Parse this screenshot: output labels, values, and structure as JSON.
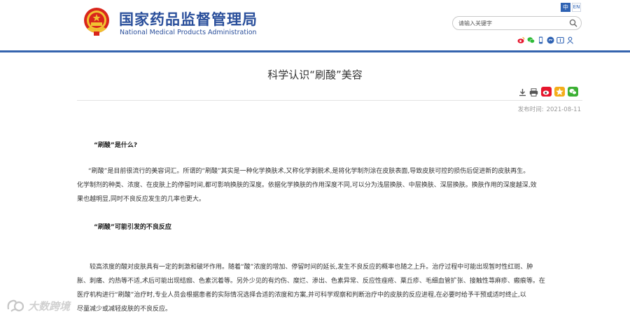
{
  "header": {
    "site_name_cn": "国家药品监督管理局",
    "site_name_en": "National Medical Products Administration",
    "lang_active": "中",
    "lang_other": "EN",
    "search_placeholder": "请输入关键字",
    "social_icons": [
      "weibo-icon",
      "wechat-icon",
      "mobile-app-icon",
      "mini-program-icon",
      "accessibility-icon",
      "user-icon"
    ]
  },
  "article": {
    "title": "科学认识“刷酸”美容",
    "tools": [
      "download-icon",
      "print-icon",
      "share-weibo-icon",
      "share-qzone-icon",
      "share-wechat-icon"
    ],
    "date_label": "发布时间:",
    "date_value": "2021-08-11",
    "heading1": "“刷酸”是什么?",
    "para1": [
      "“刷酸”是目前很流行的美容词汇。所谓的“刷酸”其实是一种化学换肤术,又称化学剥脱术,是将化学制剂涂在皮肤表面,导致皮肤可控的损伤后促进新的皮肤再生。",
      "化学制剂的种类、浓度、在皮肤上的停留时间,都可影响换肤的深度。依据化学换肤的作用深度不同,可以分为浅层换肤、中层换肤、深层换肤。换肤作用的深度越深,效",
      "果也越明显,同时不良反应发生的几率也更大。"
    ],
    "heading2": "“刷酸”可能引发的不良反应",
    "para2": [
      "较高浓度的酸对皮肤具有一定的刺激和破坏作用。随着“酸”浓度的增加、停留时间的延长,发生不良反应的概率也随之上升。治疗过程中可能出现暂时性红斑、肿",
      "胀、刺痛、灼热等不适,术后可能出现结痂、色素沉着等。另外少见的有灼伤、糜烂、渗出、色素异常、反应性痤疮、粟丘疹、毛细血管扩张、接触性荨麻疹、瘢痕等。在",
      "医疗机构进行“刷酸”治疗时,专业人员会根据患者的实际情况选择合适的浓度和方案,并可科学观察和判断治疗中的皮肤的反应进程,在必要时给予干预或适时终止,以",
      "尽量减少或减轻皮肤的不良反应。"
    ]
  },
  "watermark": "大数跨境",
  "colors": {
    "brand_blue": "#2a4f9b",
    "rule_blue": "#3564ae"
  }
}
